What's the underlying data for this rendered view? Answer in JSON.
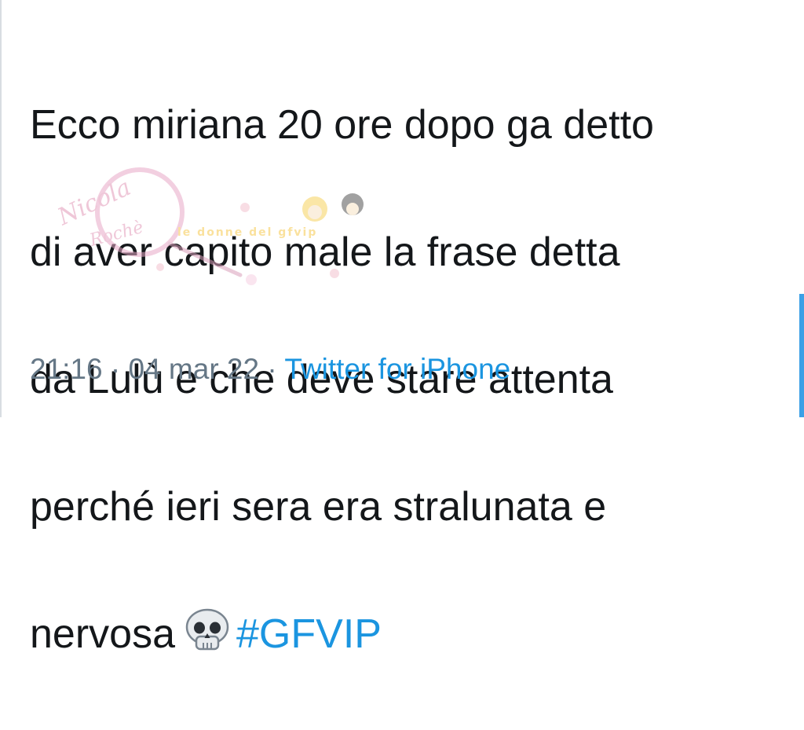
{
  "tweet": {
    "lines": [
      "Ecco miriana 20 ore dopo ga detto",
      "di aver capito male la frase detta",
      "da Lulù e che deve stare attenta",
      "perché ieri sera era stralunata e",
      "nervosa"
    ],
    "emoji": "skull-icon",
    "hashtag": "#GFVIP",
    "time": "21:16",
    "separator": "·",
    "date": "04 mar 22",
    "source": "Twitter for iPhone"
  },
  "watermark": {
    "text": "Nicola Rochè",
    "subtext": "le donne del gfvip"
  },
  "colors": {
    "text": "#14171a",
    "link": "#1b95e0",
    "meta": "#657786",
    "scroll": "#3ba0e6"
  }
}
